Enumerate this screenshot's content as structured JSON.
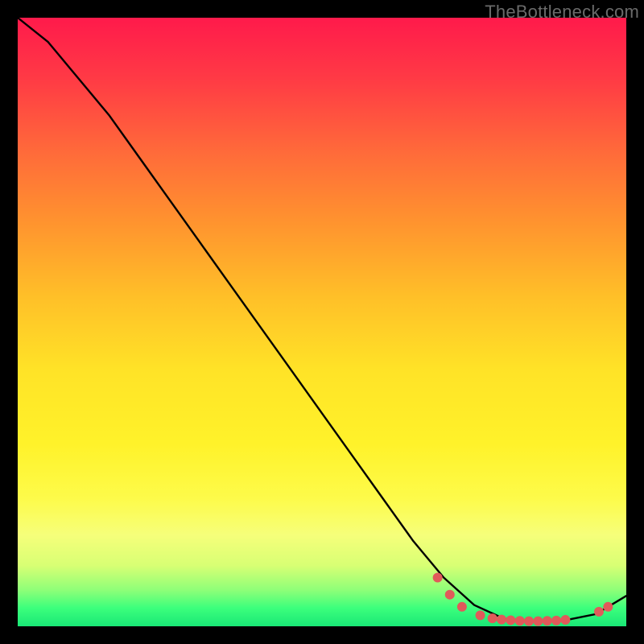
{
  "watermark": "TheBottleneck.com",
  "chart_data": {
    "type": "line",
    "x": [
      0,
      5,
      10,
      15,
      20,
      25,
      30,
      35,
      40,
      45,
      50,
      55,
      60,
      65,
      70,
      75,
      80,
      85,
      90,
      95,
      100
    ],
    "title": "",
    "xlabel": "",
    "ylabel": "",
    "xlim": [
      0,
      100
    ],
    "ylim": [
      0,
      100
    ],
    "series": [
      {
        "name": "bottleneck-curve",
        "values": [
          100,
          96,
          90,
          84,
          77,
          70,
          63,
          56,
          49,
          42,
          35,
          28,
          21,
          14,
          8,
          3.5,
          1.2,
          0.8,
          1.0,
          2.0,
          5.0
        ],
        "color": "#000000"
      }
    ],
    "markers": [
      {
        "x": 69,
        "y": 8.0
      },
      {
        "x": 71,
        "y": 5.2
      },
      {
        "x": 73,
        "y": 3.2
      },
      {
        "x": 76,
        "y": 1.8
      },
      {
        "x": 78,
        "y": 1.3
      },
      {
        "x": 79.5,
        "y": 1.1
      },
      {
        "x": 81,
        "y": 1.0
      },
      {
        "x": 82.5,
        "y": 0.9
      },
      {
        "x": 84,
        "y": 0.85
      },
      {
        "x": 85.5,
        "y": 0.85
      },
      {
        "x": 87,
        "y": 0.9
      },
      {
        "x": 88.5,
        "y": 0.95
      },
      {
        "x": 90,
        "y": 1.05
      },
      {
        "x": 95.5,
        "y": 2.4
      },
      {
        "x": 97,
        "y": 3.2
      }
    ],
    "marker_color": "#e05a5a",
    "marker_radius": 6
  }
}
